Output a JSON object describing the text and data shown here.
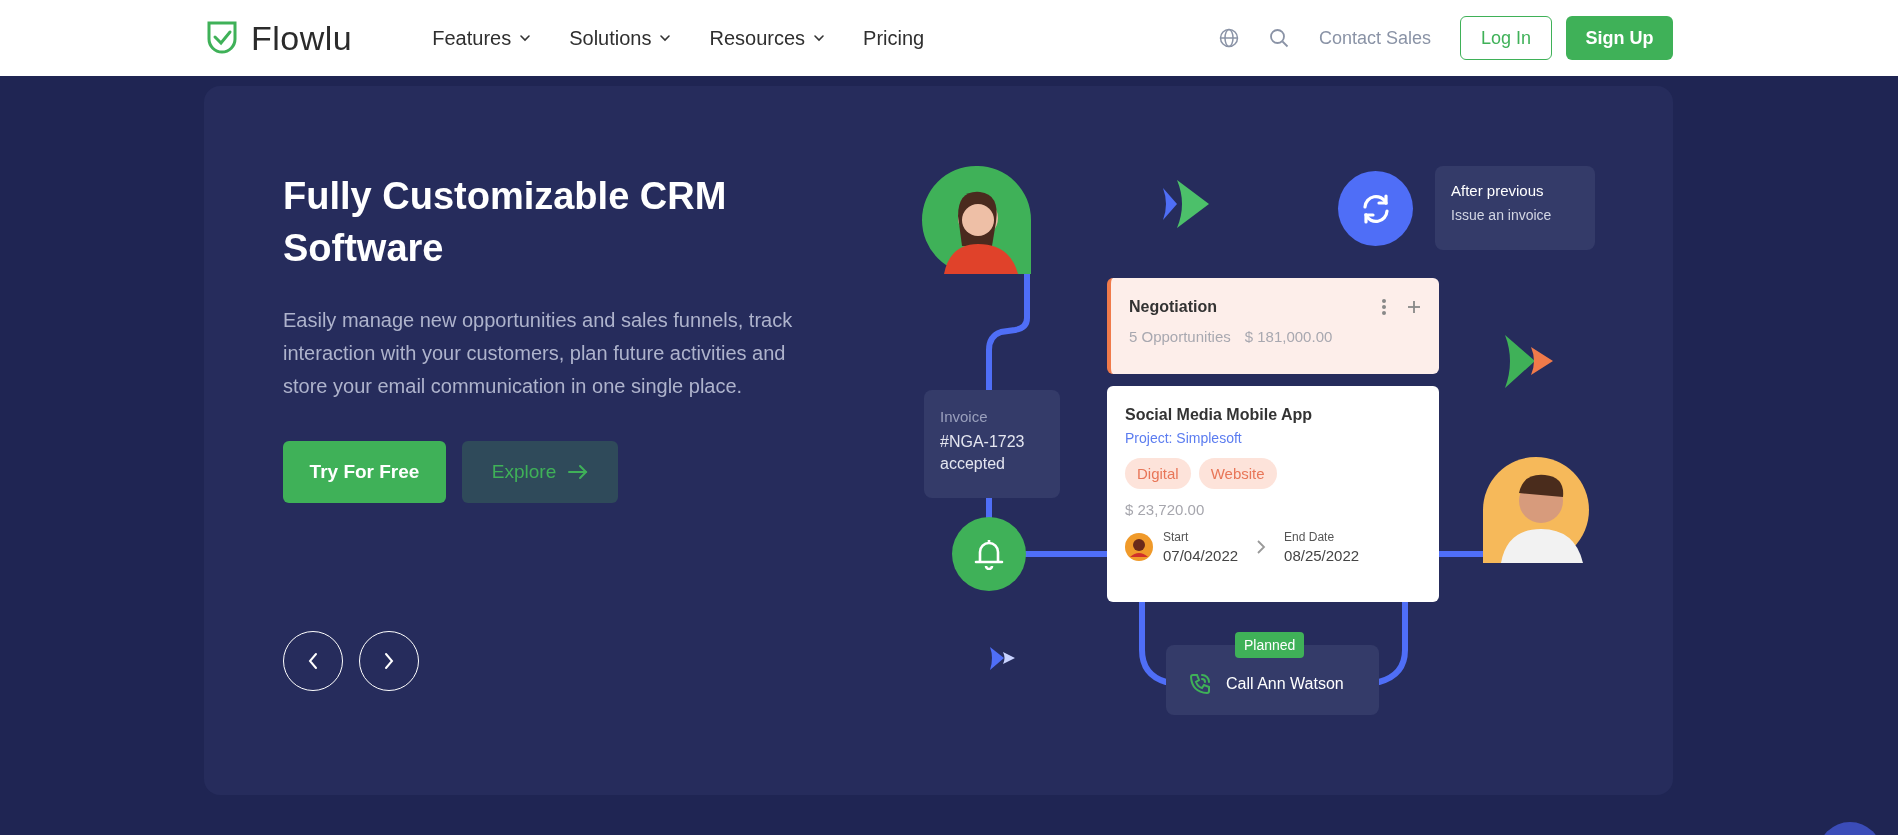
{
  "header": {
    "logo": "Flowlu",
    "nav": [
      {
        "label": "Features",
        "dropdown": true
      },
      {
        "label": "Solutions",
        "dropdown": true
      },
      {
        "label": "Resources",
        "dropdown": true
      },
      {
        "label": "Pricing",
        "dropdown": false
      }
    ],
    "contact": "Contact Sales",
    "login": "Log In",
    "signup": "Sign Up"
  },
  "hero": {
    "title": "Fully Customizable CRM Software",
    "description": "Easily manage new opportunities and sales funnels, track interaction with your customers, plan future activities and store your email communication in one single place.",
    "buttons": [
      {
        "label": "Try For Free",
        "kind": "primary"
      },
      {
        "label": "Explore",
        "kind": "secondary"
      }
    ]
  },
  "illustration": {
    "automation": {
      "title": "After previous",
      "action": "Issue an invoice"
    },
    "negotiation": {
      "title": "Negotiation",
      "count": "5 Opportunities",
      "amount": "$ 181,000.00"
    },
    "deal": {
      "title": "Social Media Mobile App",
      "project": "Project: Simplesoft",
      "tags": [
        {
          "label": "Digital"
        },
        {
          "label": "Website"
        }
      ],
      "amount": "$ 23,720.00",
      "start_label": "Start",
      "start": "07/04/2022",
      "end_label": "End Date",
      "end": "08/25/2022"
    },
    "invoice": {
      "label": "Invoice",
      "text": "#NGA-1723 accepted"
    },
    "task": {
      "badge": "Planned",
      "title": "Call Ann Watson"
    }
  }
}
